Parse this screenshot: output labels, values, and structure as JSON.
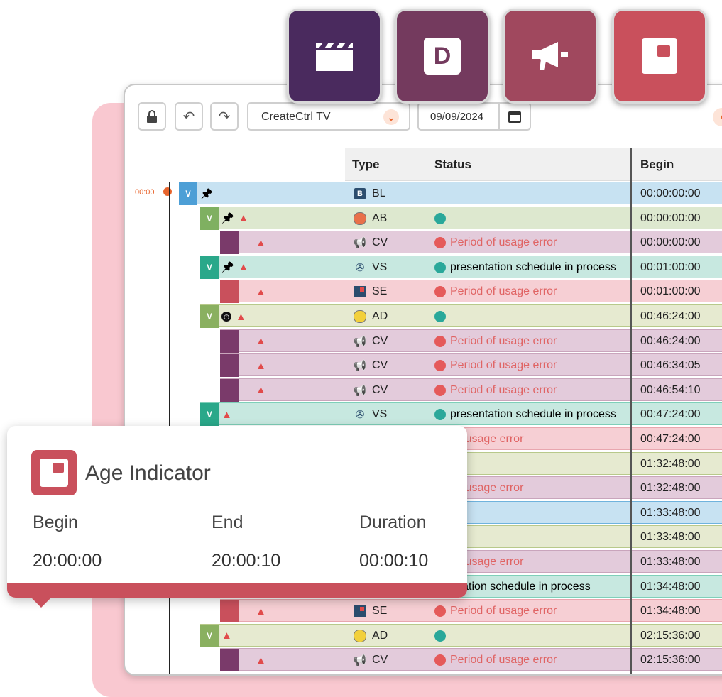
{
  "toolbar": {
    "channel_select": "CreateCtrl TV",
    "date": "09/09/2024"
  },
  "table": {
    "headers": {
      "type": "Type",
      "status": "Status",
      "begin": "Begin"
    },
    "timeline_start": "00:00",
    "rows": [
      {
        "type": "BL",
        "status": "",
        "begin": "00:00:00:00"
      },
      {
        "type": "AB",
        "status": "",
        "begin": "00:00:00:00"
      },
      {
        "type": "CV",
        "status": "Period of usage error",
        "begin": "00:00:00:00"
      },
      {
        "type": "VS",
        "status": "presentation schedule in process",
        "begin": "00:01:00:00"
      },
      {
        "type": "SE",
        "status": "Period of usage error",
        "begin": "00:01:00:00"
      },
      {
        "type": "AD",
        "status": "",
        "begin": "00:46:24:00"
      },
      {
        "type": "CV",
        "status": "Period of usage error",
        "begin": "00:46:24:00"
      },
      {
        "type": "CV",
        "status": "Period of usage error",
        "begin": "00:46:34:05"
      },
      {
        "type": "CV",
        "status": "Period of usage error",
        "begin": "00:46:54:10"
      },
      {
        "type": "VS",
        "status": "presentation schedule in process",
        "begin": "00:47:24:00"
      },
      {
        "type": "",
        "status": "iod of usage error",
        "begin": "00:47:24:00"
      },
      {
        "type": "",
        "status": "",
        "begin": "01:32:48:00"
      },
      {
        "type": "",
        "status": "iod of usage error",
        "begin": "01:32:48:00"
      },
      {
        "type": "",
        "status": "",
        "begin": "01:33:48:00"
      },
      {
        "type": "",
        "status": "",
        "begin": "01:33:48:00"
      },
      {
        "type": "",
        "status": "iod of usage error",
        "begin": "01:33:48:00"
      },
      {
        "type": "",
        "status": "esentation schedule in process",
        "begin": "01:34:48:00"
      },
      {
        "type": "SE",
        "status": "Period of usage error",
        "begin": "01:34:48:00"
      },
      {
        "type": "AD",
        "status": "",
        "begin": "02:15:36:00"
      },
      {
        "type": "CV",
        "status": "Period of usage error",
        "begin": "02:15:36:00"
      }
    ]
  },
  "popup": {
    "title": "Age Indicator",
    "begin_label": "Begin",
    "end_label": "End",
    "duration_label": "Duration",
    "begin_value": "20:00:00",
    "end_value": "20:00:10",
    "duration_value": "00:00:10"
  },
  "tiles": [
    {
      "icon": "clapperboard-icon",
      "color": "#4a2a5e"
    },
    {
      "icon": "d-letter-icon",
      "color": "#743a5e"
    },
    {
      "icon": "megaphone-icon",
      "color": "#a0485e"
    },
    {
      "icon": "age-indicator-icon",
      "color": "#c9505c"
    }
  ],
  "colors": {
    "bl_row": "#c7e2f2",
    "ab_row": "#dde8cf",
    "cv_row": "#e3cbdb",
    "vs_row": "#c7e8e0",
    "se_row": "#f6cfd4",
    "ad_row": "#e6ead0",
    "accent": "#e8642c"
  }
}
